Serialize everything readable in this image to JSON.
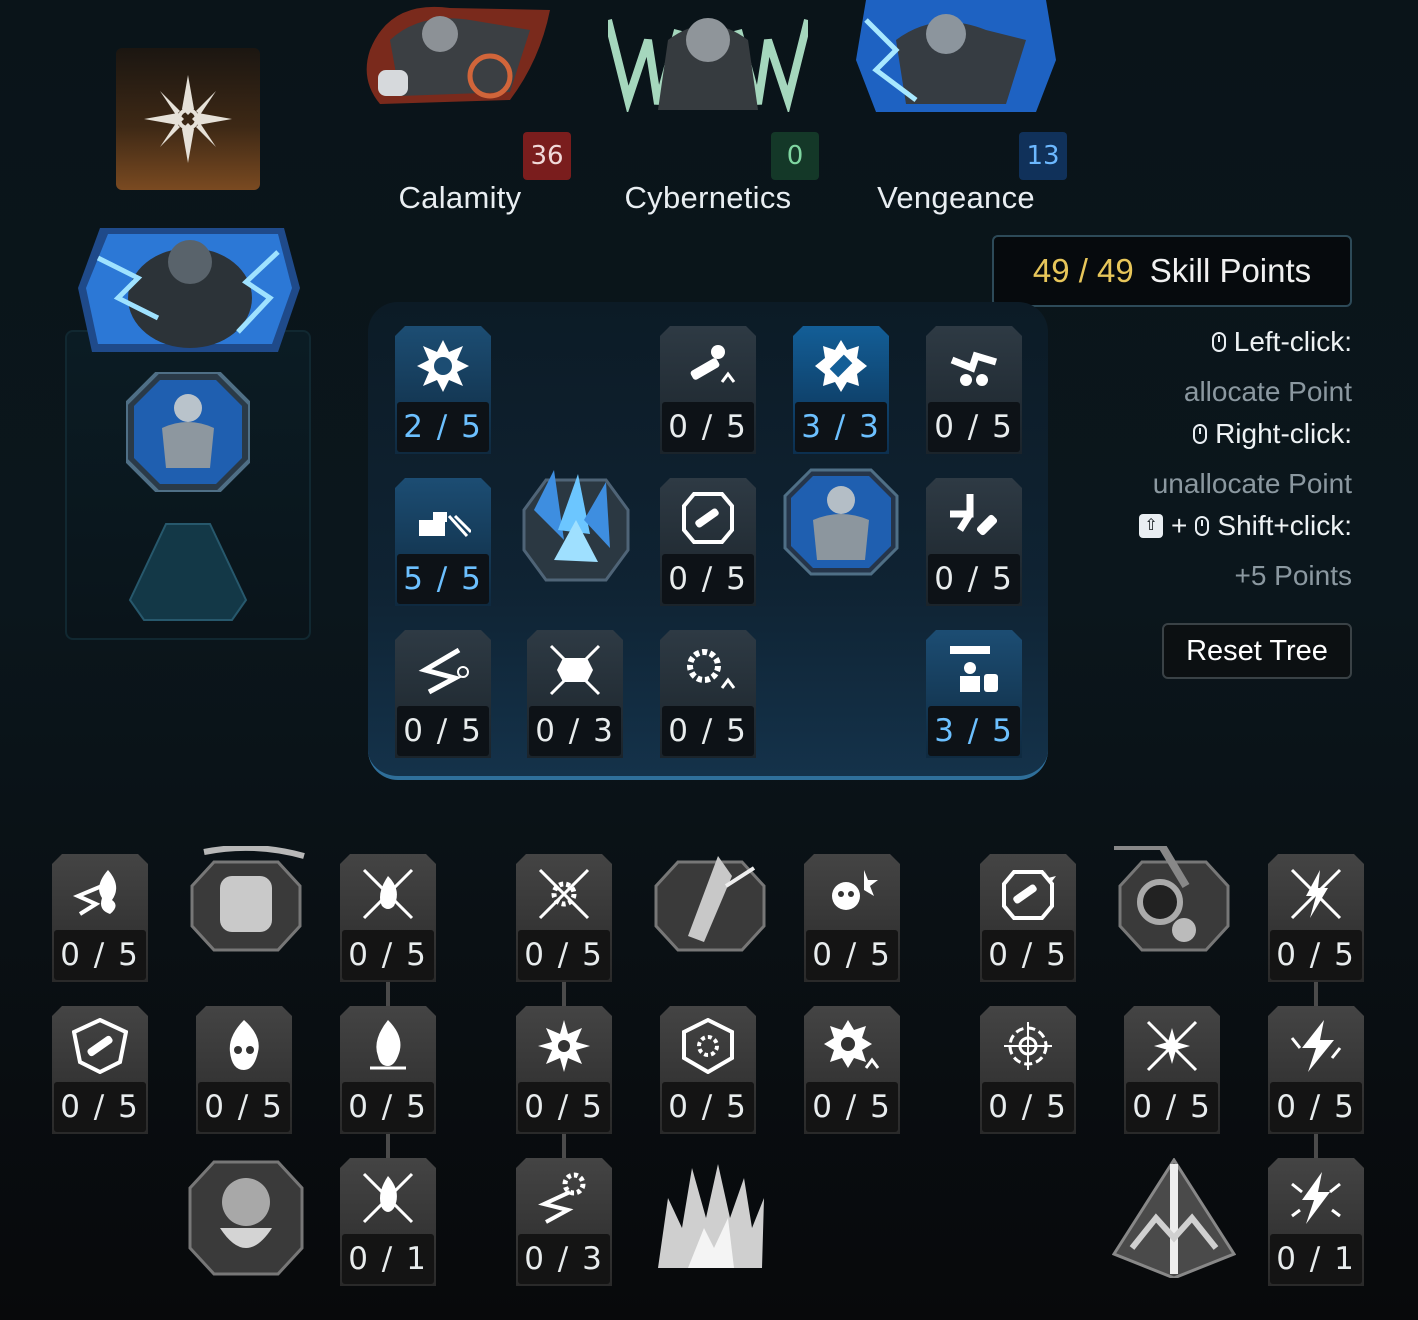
{
  "trees": [
    {
      "name": "Calamity",
      "points": "36",
      "color": "#7a1d1d"
    },
    {
      "name": "Cybernetics",
      "points": "0",
      "color": "#16402d"
    },
    {
      "name": "Vengeance",
      "points": "13",
      "color": "#133a66"
    }
  ],
  "skill_points": {
    "value": "49 / 49",
    "label": "Skill Points"
  },
  "help": {
    "left_click": "Left-click:",
    "left_desc": "allocate Point",
    "right_click": "Right-click:",
    "right_desc": "unallocate Point",
    "plus": "+",
    "shift_click": "Shift+click:",
    "shift_desc": "+5 Points"
  },
  "reset_label": "Reset Tree",
  "vengeance_grid": {
    "r1": [
      "2 / 5",
      "0 / 5",
      "3 / 3",
      "0 / 5"
    ],
    "r2": [
      "5 / 5",
      "0 / 5",
      "0 / 5"
    ],
    "r3": [
      "0 / 5",
      "0 / 3",
      "0 / 5",
      "3 / 5"
    ]
  },
  "lower": {
    "calamity": {
      "a": [
        "0 / 5",
        "0 / 5"
      ],
      "b": [
        "0 / 5",
        "0 / 5",
        "0 / 5"
      ],
      "c": [
        "0 / 1"
      ]
    },
    "middle": {
      "a": [
        "0 / 5",
        "0 / 5"
      ],
      "b": [
        "0 / 5",
        "0 / 5",
        "0 / 5"
      ],
      "c": [
        "0 / 3"
      ]
    },
    "right": {
      "a": [
        "0 / 5",
        "0 / 5"
      ],
      "b": [
        "0 / 5",
        "0 / 5",
        "0 / 5"
      ],
      "c": [
        "0 / 1"
      ]
    }
  },
  "icons": {
    "class": "class-emblem-icon"
  }
}
